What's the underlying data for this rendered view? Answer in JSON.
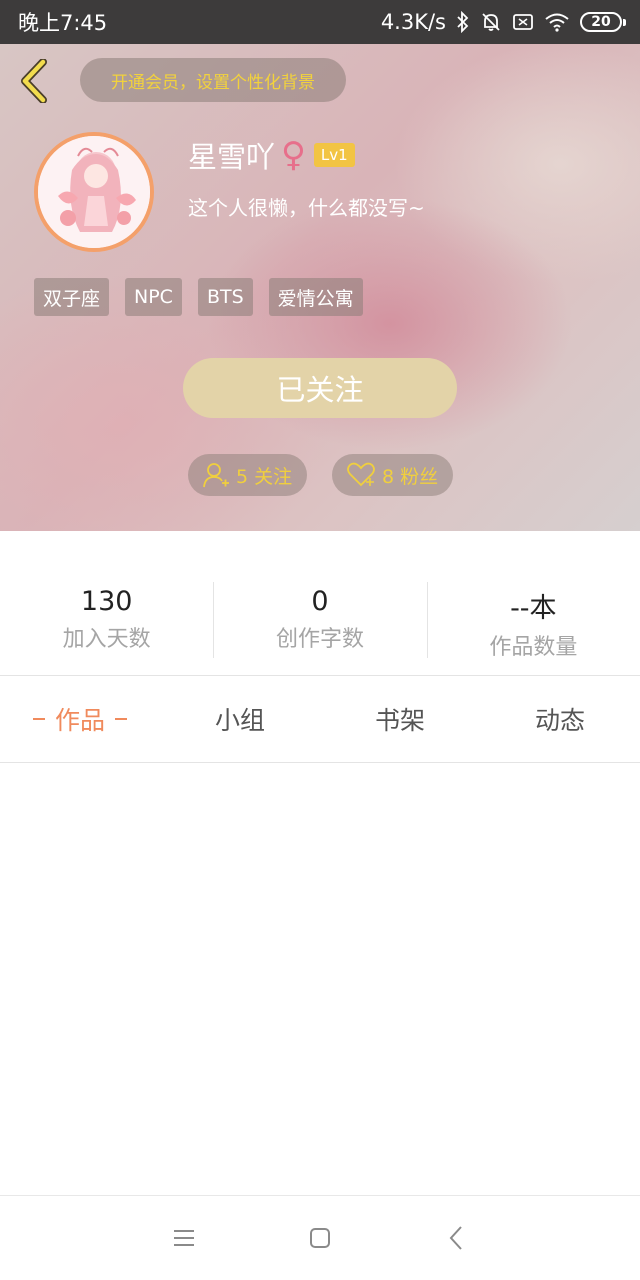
{
  "status_bar": {
    "time": "晚上7:45",
    "network_speed": "4.3K/s",
    "battery": "20",
    "icons": [
      "bluetooth-icon",
      "mute-bell-icon",
      "sim-icon",
      "wifi-icon",
      "battery-icon"
    ]
  },
  "header": {
    "back_icon": "chevron-left-icon",
    "vip_banner": "开通会员，设置个性化背景"
  },
  "profile": {
    "username": "星雪吖",
    "gender_symbol": "♀",
    "level": "Lv1",
    "bio": "这个人很懒，什么都没写~",
    "tags": [
      "双子座",
      "NPC",
      "BTS",
      "爱情公寓"
    ],
    "follow_button": "已关注",
    "following_label": "5 关注",
    "fans_label": "8 粉丝"
  },
  "stats": [
    {
      "value": "130",
      "label": "加入天数"
    },
    {
      "value": "0",
      "label": "创作字数"
    },
    {
      "value": "--本",
      "label": "作品数量"
    }
  ],
  "tabs": [
    {
      "label": "作品",
      "active": true
    },
    {
      "label": "小组",
      "active": false
    },
    {
      "label": "书架",
      "active": false
    },
    {
      "label": "动态",
      "active": false
    }
  ],
  "colors": {
    "accent": "#f08a5c",
    "gold": "#f0cf3e",
    "follow_button": "#e3d3a8",
    "status_bar": "#3d3b3b"
  },
  "nav_bar": [
    "menu-icon",
    "home-square-icon",
    "back-icon"
  ]
}
